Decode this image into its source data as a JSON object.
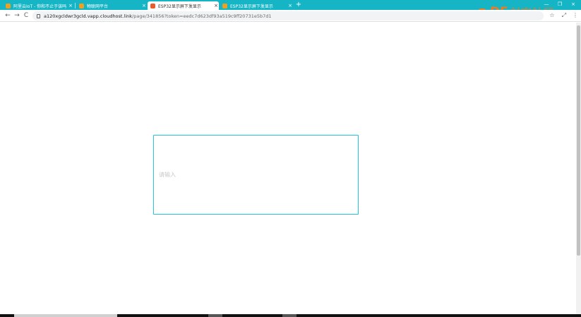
{
  "tabs": [
    {
      "title": "阿里云IoT - 你和不止于该吗",
      "close": "×"
    },
    {
      "title": "物联网平台",
      "close": "×"
    },
    {
      "title": "ESP32显示屏下发显示",
      "close": "×",
      "active": true
    },
    {
      "title": "ESP32显示屏下发显示",
      "close": "×"
    }
  ],
  "new_tab_label": "+",
  "window_controls": [
    "—",
    "❐",
    "×"
  ],
  "logo": {
    "text": "DF",
    "subtext": "创客社区"
  },
  "nav": {
    "back": "←",
    "forward": "→",
    "reload": "C"
  },
  "address": {
    "host": "a120xgcldwr3gcld.vapp.cloudhost.link",
    "path": "/page/341856?token=eedc7d623df93a519c9ff20731e5b7d1"
  },
  "toolbar_icons": [
    "☆",
    "⤢",
    "⋮"
  ],
  "main": {
    "input_placeholder": "请输入"
  },
  "colors": {
    "tabbar": "#16b5c6",
    "input_border": "#22c7dc",
    "logo": "#f07a20"
  }
}
